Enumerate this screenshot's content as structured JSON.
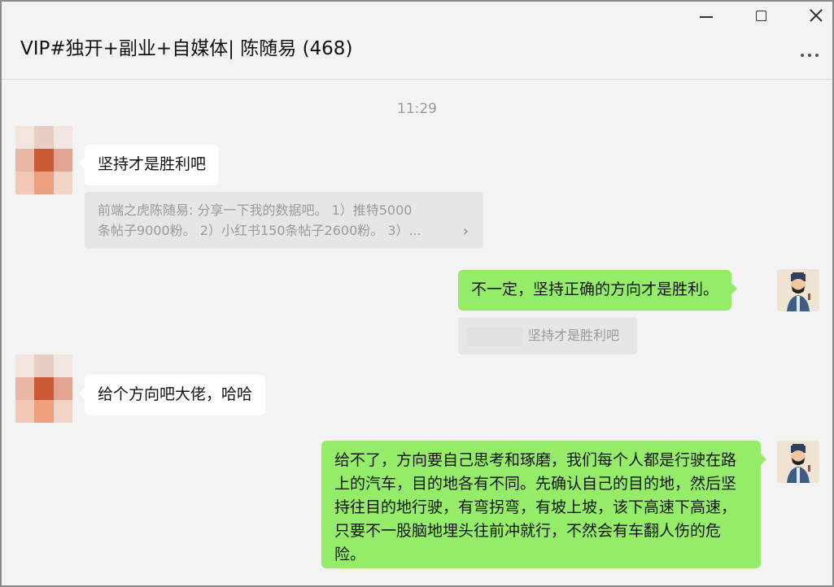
{
  "window": {
    "title": "VIP#独开+副业+自媒体| 陈随易 (468)"
  },
  "chat": {
    "timestamp": "11:29",
    "messages": [
      {
        "side": "left",
        "text": "坚持才是胜利吧"
      },
      {
        "side": "right",
        "text": "不一定，坚持正确的方向才是胜利。"
      },
      {
        "side": "left",
        "text": "给个方向吧大佬，哈哈"
      },
      {
        "side": "right",
        "text": "给不了，方向要自己思考和琢磨，我们每个人都是行驶在路上的汽车，目的地各有不同。先确认自己的目的地，然后坚持往目的地行驶，有弯拐弯，有坡上坡，该下高速下高速，只要不一股脑地埋头往前冲就行，不然会有车翻人伤的危险。"
      }
    ],
    "quote1": {
      "line1": "前端之虎陈随易: 分享一下我的数据吧。 1）推特5000",
      "line2": "条帖子9000粉。 2）小红书150条帖子2600粉。 3）..."
    },
    "quote2": {
      "text": "坚持才是胜利吧"
    }
  },
  "icons": {
    "minimize": "minimize-icon",
    "maximize": "maximize-icon",
    "close": "close-icon",
    "more": "more-icon",
    "chevron": "chevron-right-icon"
  },
  "colors": {
    "bubble_green": "#95ec69",
    "bubble_white": "#ffffff",
    "background": "#f3f3f3"
  }
}
